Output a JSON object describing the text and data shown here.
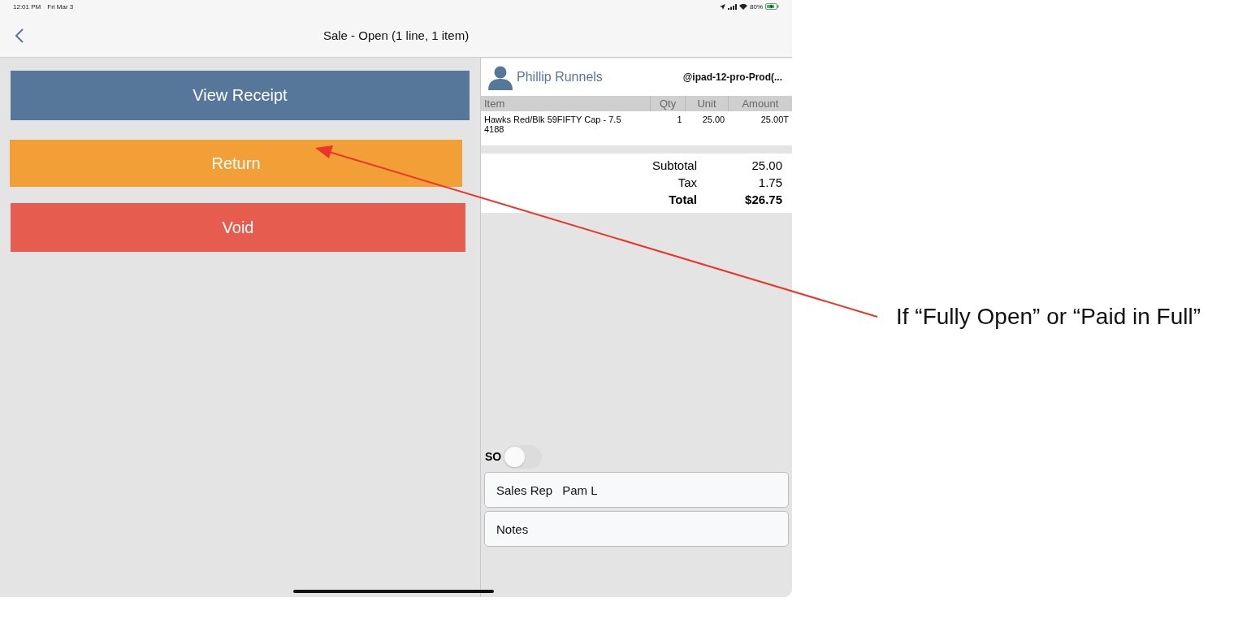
{
  "status_bar": {
    "time": "12:01 PM",
    "date": "Fri Mar 3",
    "battery": "80%"
  },
  "nav_bar": {
    "title": "Sale - Open (1 line, 1 item)"
  },
  "actions": [
    {
      "label": "View Receipt",
      "color": "#56769a"
    },
    {
      "label": "Return",
      "color": "#f29f38"
    },
    {
      "label": "Void",
      "color": "#e65c4e"
    }
  ],
  "customer": {
    "name": "Phillip Runnels",
    "device": "@ipad-12-pro-Prod(..."
  },
  "table": {
    "columns": [
      "Item",
      "Qty",
      "Unit",
      "Amount"
    ],
    "rows": [
      {
        "item": "Hawks Red/Blk 59FIFTY Cap - 7.5\n4188",
        "qty": "1",
        "unit": "25.00",
        "amount": "25.00T"
      }
    ]
  },
  "totals": [
    {
      "kind": "line",
      "label": "Subtotal",
      "value": "25.00"
    },
    {
      "kind": "line",
      "label": "Tax",
      "value": "1.75"
    },
    {
      "kind": "total",
      "label": "Total",
      "value": "$26.75"
    }
  ],
  "so_toggle": {
    "label": "SO",
    "on": false
  },
  "fields": [
    {
      "label": "Sales Rep",
      "value": "Pam L"
    },
    {
      "label": "Notes"
    }
  ],
  "annotation": {
    "text": "If  “Fully Open” or “Paid in Full”"
  }
}
